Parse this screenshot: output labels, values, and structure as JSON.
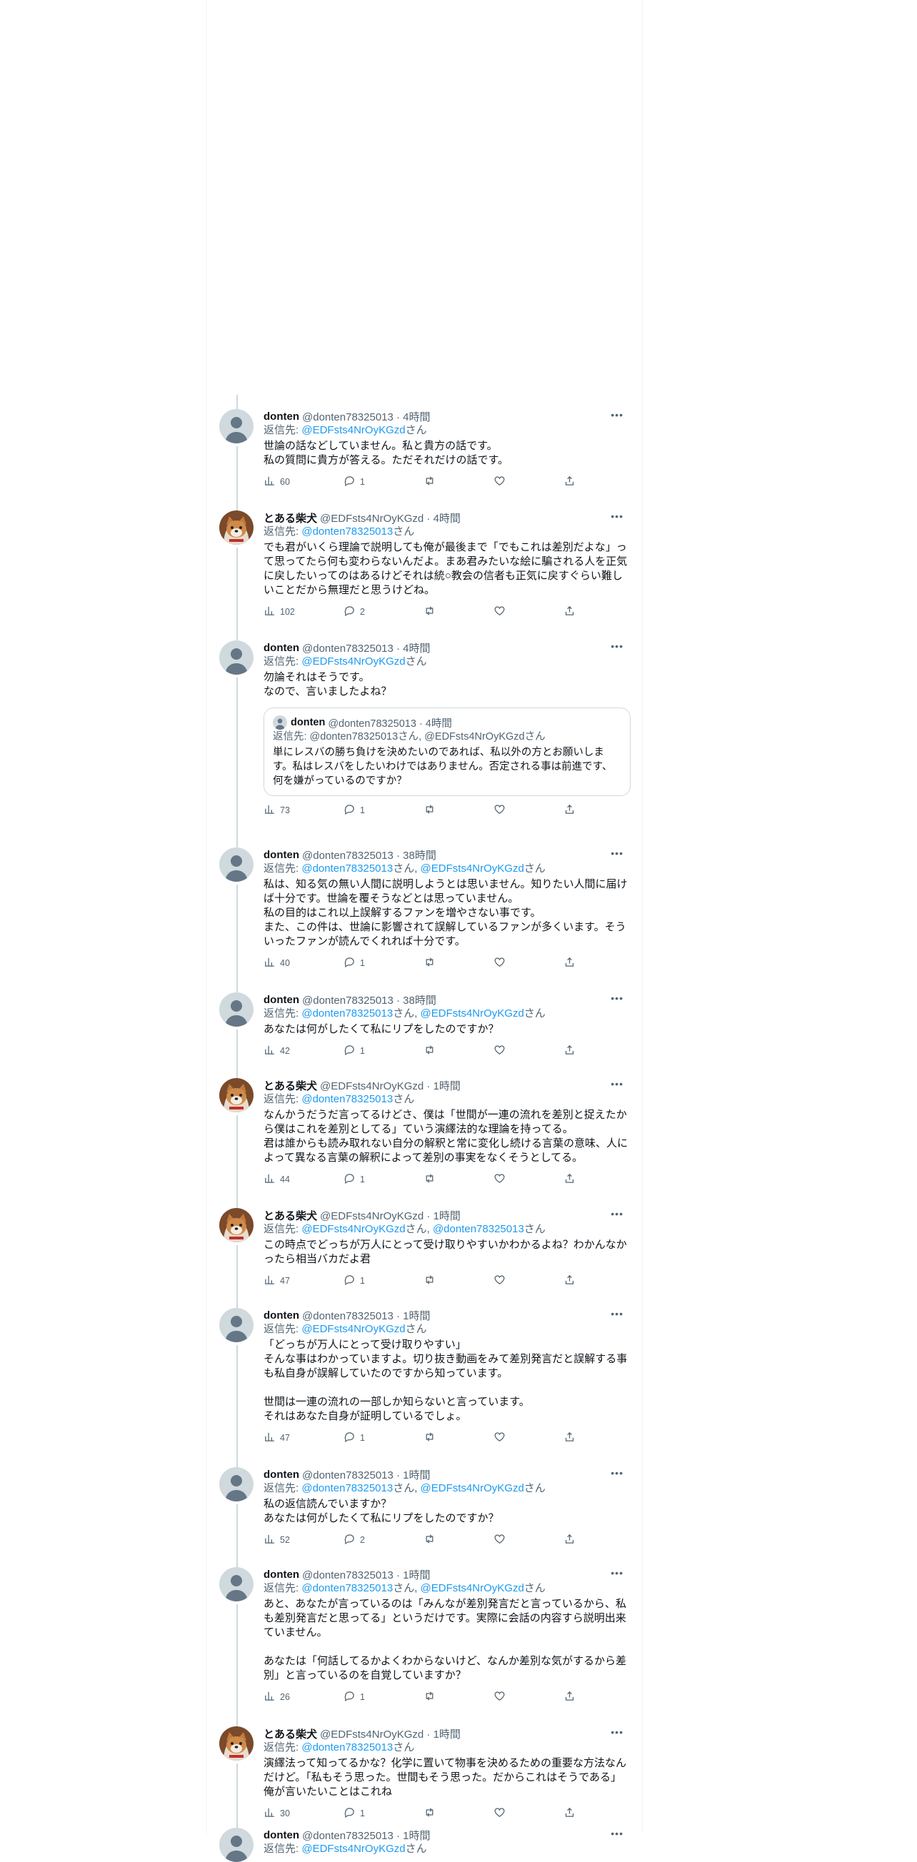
{
  "reply_prefix": "返信先:",
  "tweets": [
    {
      "author_type": "donten",
      "name": "donten",
      "meta": "@donten78325013 · 4時間",
      "reply_to": [
        {
          "handle": "@EDFsts4NrOyKGzd",
          "suffix": "さん"
        }
      ],
      "text": "世論の話などしていません。私と貴方の話です。\n私の質問に貴方が答える。ただそれだけの話です。",
      "views": "60",
      "replies": "1"
    },
    {
      "author_type": "shiba",
      "name": "とある柴犬",
      "meta": "@EDFsts4NrOyKGzd · 4時間",
      "reply_to": [
        {
          "handle": "@donten78325013",
          "suffix": "さん"
        }
      ],
      "text": "でも君がいくら理論で説明しても俺が最後まで「でもこれは差別だよな」って思ってたら何も変わらないんだよ。まあ君みたいな絵に騙される人を正気に戻したいってのはあるけどそれは統○教会の信者も正気に戻すぐらい難しいことだから無理だと思うけどね。",
      "views": "102",
      "replies": "2"
    },
    {
      "author_type": "donten",
      "name": "donten",
      "meta": "@donten78325013 · 4時間",
      "reply_to": [
        {
          "handle": "@EDFsts4NrOyKGzd",
          "suffix": "さん"
        }
      ],
      "text": "勿論それはそうです。\nなので、言いましたよね？",
      "views": "73",
      "replies": "1",
      "quote": {
        "name": "donten",
        "meta": "@donten78325013 · 4時間",
        "reply_line": "返信先: @donten78325013さん, @EDFsts4NrOyKGzdさん",
        "text": "単にレスバの勝ち負けを決めたいのであれば、私以外の方とお願いします。私はレスバをしたいわけではありません。否定される事は前進です、何を嫌がっているのですか？"
      }
    },
    {
      "author_type": "donten",
      "name": "donten",
      "meta": "@donten78325013 · 38時間",
      "reply_to": [
        {
          "handle": "@donten78325013",
          "suffix": "さん, "
        },
        {
          "handle": "@EDFsts4NrOyKGzd",
          "suffix": "さん"
        }
      ],
      "text": "私は、知る気の無い人間に説明しようとは思いません。知りたい人間に届けば十分です。世論を覆そうなどとは思っていません。\n私の目的はこれ以上誤解するファンを増やさない事です。\nまた、この件は、世論に影響されて誤解しているファンが多くいます。そういったファンが読んでくれれば十分です。",
      "views": "40",
      "replies": "1"
    },
    {
      "author_type": "donten",
      "name": "donten",
      "meta": "@donten78325013 · 38時間",
      "reply_to": [
        {
          "handle": "@donten78325013",
          "suffix": "さん, "
        },
        {
          "handle": "@EDFsts4NrOyKGzd",
          "suffix": "さん"
        }
      ],
      "text": "あなたは何がしたくて私にリプをしたのですか？",
      "views": "42",
      "replies": "1"
    },
    {
      "author_type": "shiba",
      "name": "とある柴犬",
      "meta": "@EDFsts4NrOyKGzd · 1時間",
      "reply_to": [
        {
          "handle": "@donten78325013",
          "suffix": "さん"
        }
      ],
      "text": "なんかうだうだ言ってるけどさ、僕は「世間が一連の流れを差別と捉えたから僕はこれを差別としてる」ていう演繹法的な理論を持ってる。\n君は誰からも読み取れない自分の解釈と常に変化し続ける言葉の意味、人によって異なる言葉の解釈によって差別の事実をなくそうとしてる。",
      "views": "44",
      "replies": "1"
    },
    {
      "author_type": "shiba",
      "name": "とある柴犬",
      "meta": "@EDFsts4NrOyKGzd · 1時間",
      "reply_to": [
        {
          "handle": "@EDFsts4NrOyKGzd",
          "suffix": "さん, "
        },
        {
          "handle": "@donten78325013",
          "suffix": "さん"
        }
      ],
      "text": "この時点でどっちが万人にとって受け取りやすいかわかるよね？わかんなかったら相当バカだよ君",
      "views": "47",
      "replies": "1"
    },
    {
      "author_type": "donten",
      "name": "donten",
      "meta": "@donten78325013 · 1時間",
      "reply_to": [
        {
          "handle": "@EDFsts4NrOyKGzd",
          "suffix": "さん"
        }
      ],
      "text": "「どっちが万人にとって受け取りやすい」\nそんな事はわかっていますよ。切り抜き動画をみて差別発言だと誤解する事も私自身が誤解していたのですから知っています。\n\n世間は一連の流れの一部しか知らないと言っています。\nそれはあなた自身が証明しているでしょ。",
      "views": "47",
      "replies": "1"
    },
    {
      "author_type": "donten",
      "name": "donten",
      "meta": "@donten78325013 · 1時間",
      "reply_to": [
        {
          "handle": "@donten78325013",
          "suffix": "さん, "
        },
        {
          "handle": "@EDFsts4NrOyKGzd",
          "suffix": "さん"
        }
      ],
      "text": "私の返信読んでいますか？\nあなたは何がしたくて私にリプをしたのですか？",
      "views": "52",
      "replies": "2"
    },
    {
      "author_type": "donten",
      "name": "donten",
      "meta": "@donten78325013 · 1時間",
      "reply_to": [
        {
          "handle": "@donten78325013",
          "suffix": "さん, "
        },
        {
          "handle": "@EDFsts4NrOyKGzd",
          "suffix": "さん"
        }
      ],
      "text": "あと、あなたが言っているのは「みんなが差別発言だと言っているから、私も差別発言だと思ってる」というだけです。実際に会話の内容すら説明出来ていません。\n\nあなたは「何話してるかよくわからないけど、なんか差別な気がするから差別」と言っているのを自覚していますか？",
      "views": "26",
      "replies": "1"
    },
    {
      "author_type": "shiba",
      "name": "とある柴犬",
      "meta": "@EDFsts4NrOyKGzd · 1時間",
      "reply_to": [
        {
          "handle": "@donten78325013",
          "suffix": "さん"
        }
      ],
      "text": "演繹法って知ってるかな？化学に置いて物事を決めるための重要な方法なんだけど。「私もそう思った。世間もそう思った。だからこれはそうである」俺が言いたいことはこれね",
      "views": "30",
      "replies": "1"
    },
    {
      "author_type": "donten",
      "name": "donten",
      "meta": "@donten78325013 · 1時間",
      "reply_to": [
        {
          "handle": "@EDFsts4NrOyKGzd",
          "suffix": "さん"
        }
      ],
      "text": "",
      "views": "",
      "replies": ""
    }
  ]
}
